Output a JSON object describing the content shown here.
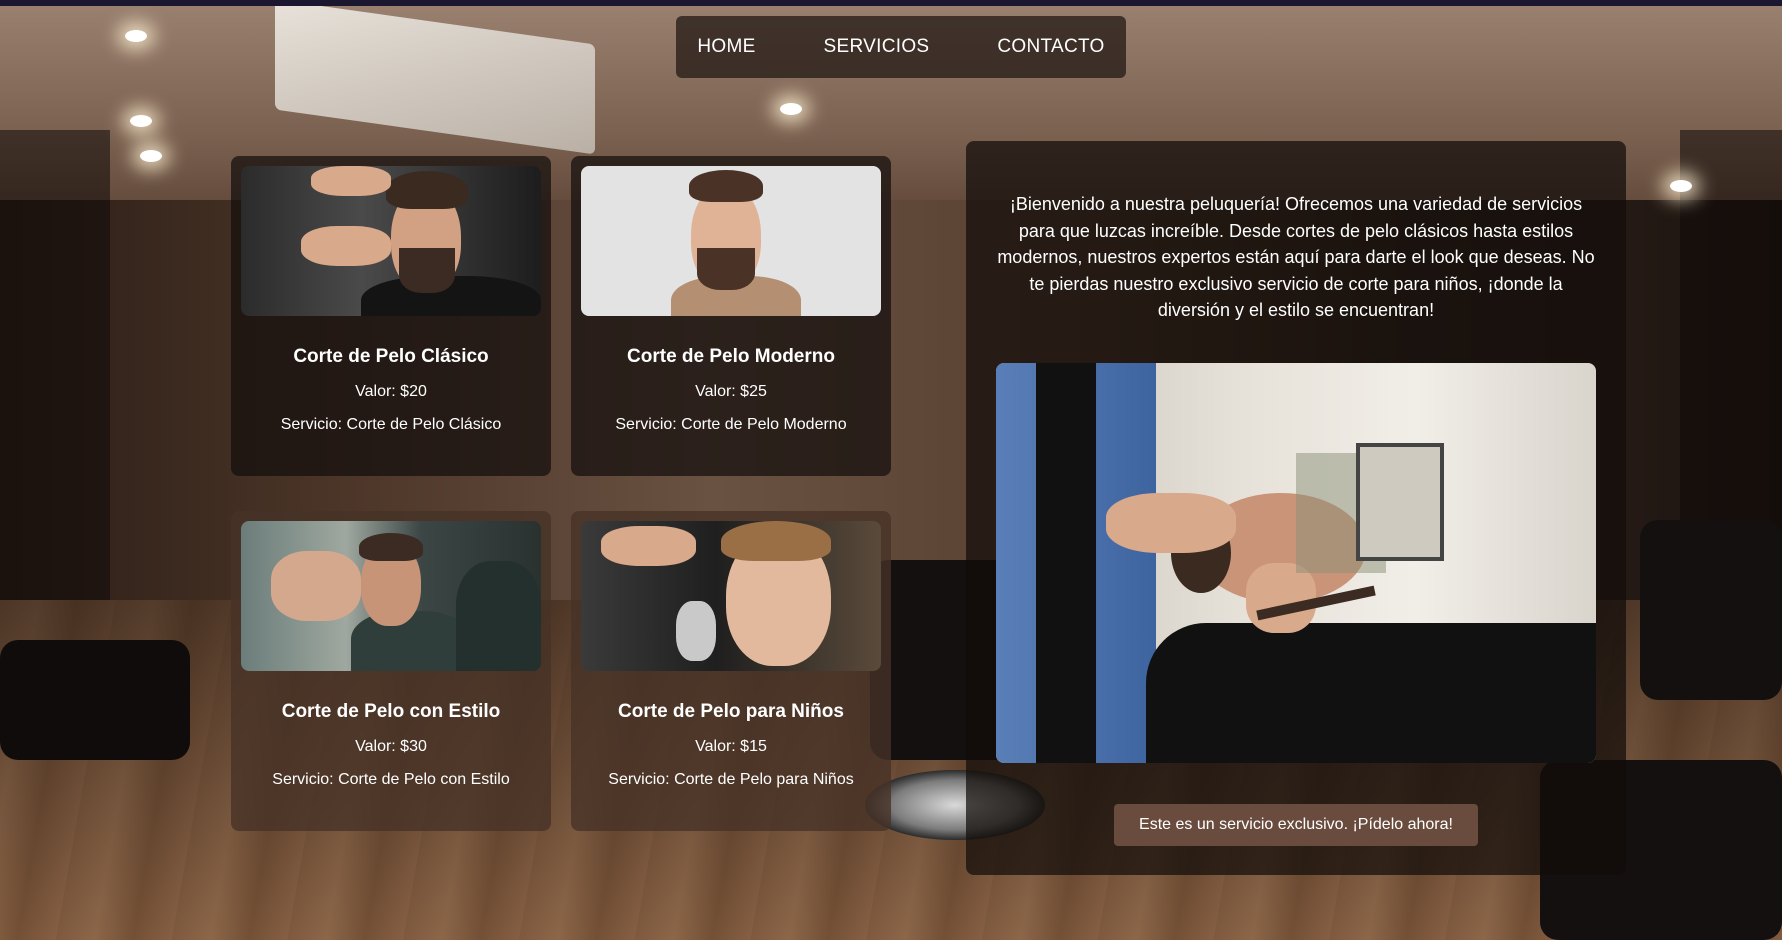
{
  "nav": {
    "items": [
      "HOME",
      "SERVICIOS",
      "CONTACTO"
    ]
  },
  "services": [
    {
      "title": "Corte de Pelo Clásico",
      "price": "Valor: $20",
      "service": "Servicio: Corte de Pelo Clásico"
    },
    {
      "title": "Corte de Pelo Moderno",
      "price": "Valor: $25",
      "service": "Servicio: Corte de Pelo Moderno"
    },
    {
      "title": "Corte de Pelo con Estilo",
      "price": "Valor: $30",
      "service": "Servicio: Corte de Pelo con Estilo"
    },
    {
      "title": "Corte de Pelo para Niños",
      "price": "Valor: $15",
      "service": "Servicio: Corte de Pelo para Niños"
    }
  ],
  "info": {
    "text": "¡Bienvenido a nuestra peluquería! Ofrecemos una variedad de servicios para que luzcas increíble. Desde cortes de pelo clásicos hasta estilos modernos, nuestros expertos están aquí para darte el look que deseas. No te pierdas nuestro exclusivo servicio de corte para niños, ¡donde la diversión y el estilo se encuentran!",
    "cta": "Este es un servicio exclusivo. ¡Pídelo ahora!"
  },
  "colors": {
    "nav_bg": "#231914",
    "card_dark": "#140e0c",
    "card_warm": "#46322a",
    "cta_bg": "#6a4c3e"
  }
}
